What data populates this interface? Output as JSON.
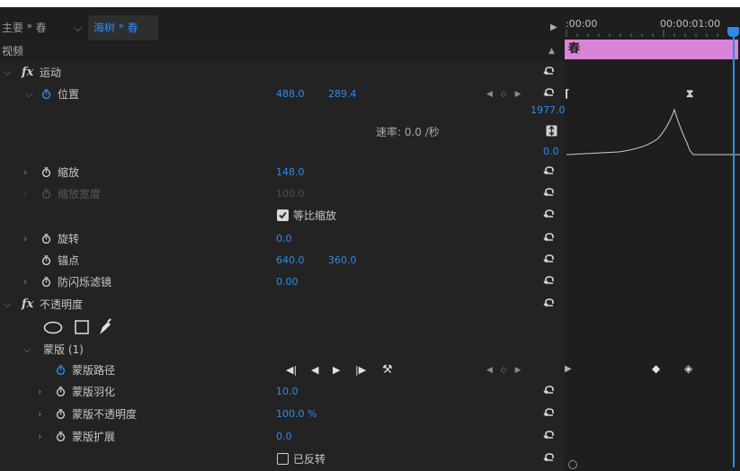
{
  "tabs": {
    "main_tab": "主要 * 春",
    "clip_tab": "海树 * 春"
  },
  "section_label": "视频",
  "timeline": {
    "time_start": ":00:00",
    "time_end": "00:00:01:00",
    "clip_label": "春",
    "graph_max": "1977.0",
    "graph_min": "0.0"
  },
  "motion": {
    "fx_label": "fx",
    "label": "运动",
    "position": {
      "label": "位置",
      "x": "488.0",
      "y": "289.4"
    },
    "speed_label": "速率: 0.0 /秒",
    "scale": {
      "label": "缩放",
      "value": "148.0"
    },
    "scale_width": {
      "label": "缩放宽度",
      "value": "100.0"
    },
    "uniform_scale": {
      "label": "等比缩放",
      "checked": true
    },
    "rotation": {
      "label": "旋转",
      "value": "0.0"
    },
    "anchor": {
      "label": "锚点",
      "x": "640.0",
      "y": "360.0"
    },
    "anti_flicker": {
      "label": "防闪烁滤镜",
      "value": "0.00"
    }
  },
  "opacity": {
    "fx_label": "fx",
    "label": "不透明度",
    "mask": {
      "label": "蒙版 (1)",
      "path": {
        "label": "蒙版路径"
      },
      "feather": {
        "label": "蒙版羽化",
        "value": "10.0"
      },
      "opacity": {
        "label": "蒙版不透明度",
        "value": "100.0 %"
      },
      "expansion": {
        "label": "蒙版扩展",
        "value": "0.0"
      },
      "inverted": {
        "label": "已反转",
        "checked": false
      }
    }
  },
  "colors": {
    "accent": "#2d8ceb",
    "clip": "#d984d6",
    "panel": "#232323",
    "timeline": "#1e1e1e"
  }
}
